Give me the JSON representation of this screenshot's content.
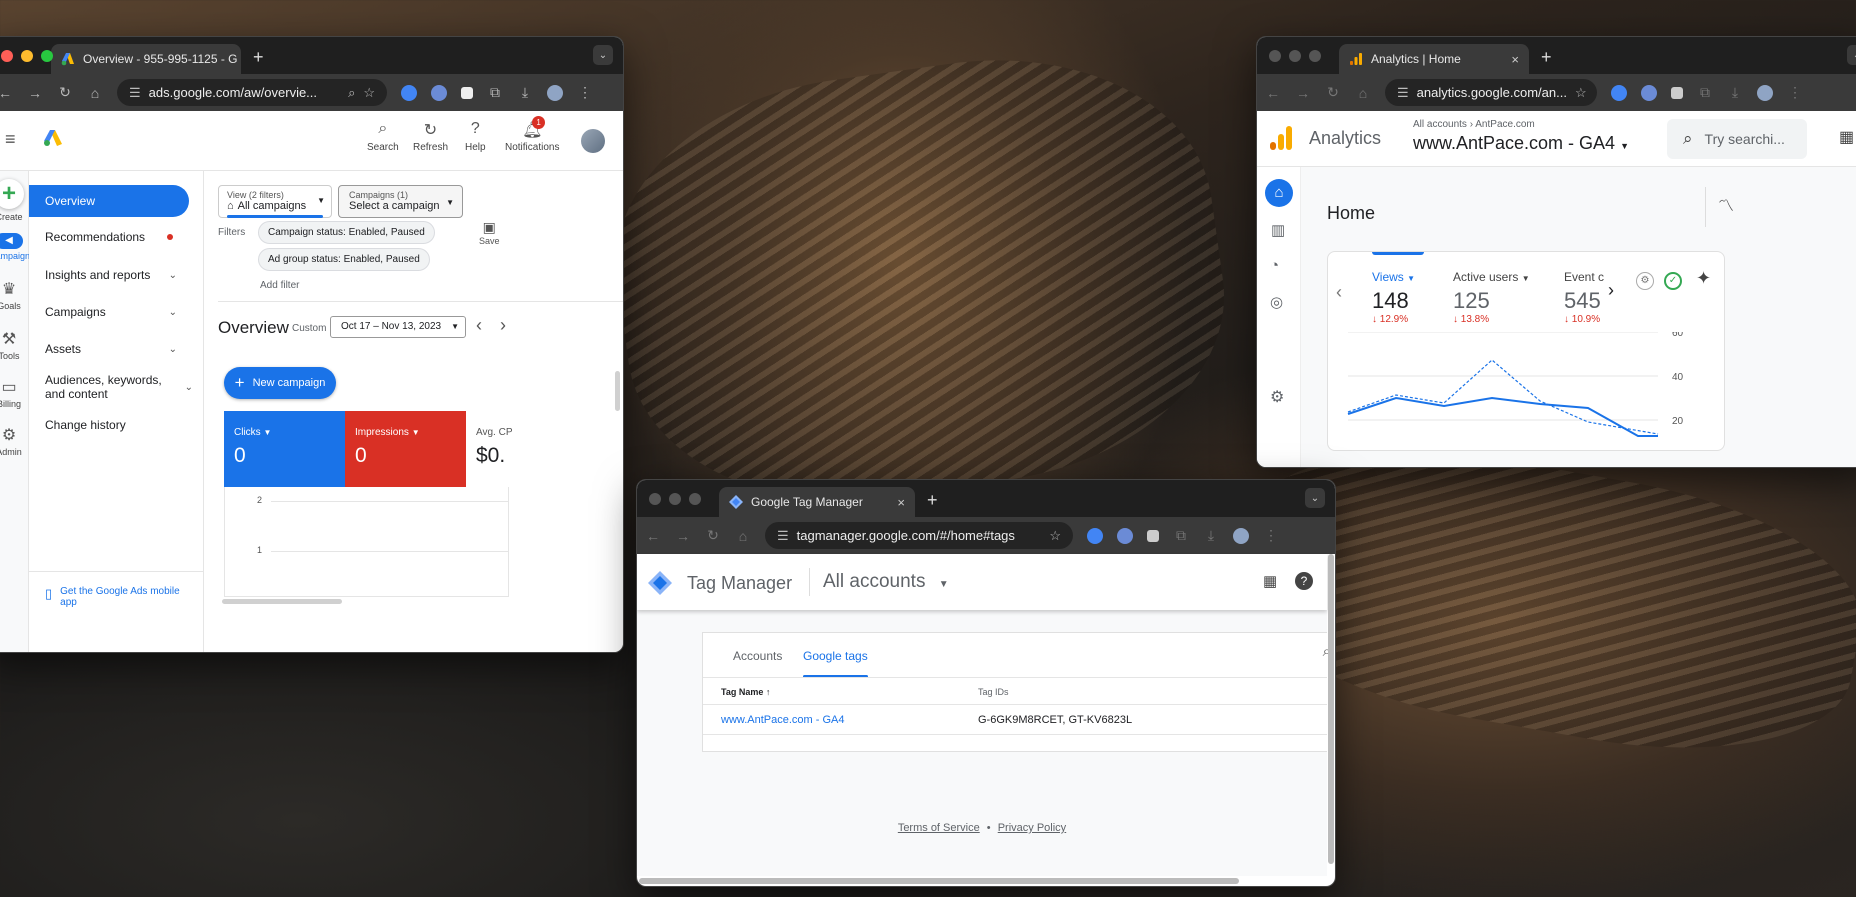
{
  "ads_window": {
    "tab_title": "Overview - 955-995-1125 - G",
    "url": "ads.google.com/aw/overvie...",
    "header": {
      "search_label": "Search",
      "refresh_label": "Refresh",
      "help_label": "Help",
      "notifications_label": "Notifications",
      "notifications_count": "1"
    },
    "rail": {
      "create": "Create",
      "campaigns": "Campaigns",
      "goals": "Goals",
      "tools": "Tools",
      "billing": "Billing",
      "admin": "Admin"
    },
    "nav": {
      "overview": "Overview",
      "recommendations": "Recommendations",
      "insights": "Insights and reports",
      "campaigns": "Campaigns",
      "assets": "Assets",
      "audiences": "Audiences, keywords, and content",
      "change_history": "Change history",
      "mobile_app": "Get the Google Ads mobile app"
    },
    "view_filter": {
      "label": "View (2 filters)",
      "value": "All campaigns"
    },
    "campaign_filter": {
      "label": "Campaigns (1)",
      "value": "Select a campaign"
    },
    "filters_label": "Filters",
    "filter_chips": [
      "Campaign status: Enabled, Paused",
      "Ad group status: Enabled, Paused"
    ],
    "add_filter": "Add filter",
    "save_label": "Save",
    "overview_title": "Overview",
    "custom_label": "Custom",
    "date_range": "Oct 17 – Nov 13, 2023",
    "new_campaign": "New campaign",
    "metrics": [
      {
        "label": "Clicks",
        "value": "0",
        "color": "#1a73e8"
      },
      {
        "label": "Impressions",
        "value": "0",
        "color": "#d93025"
      },
      {
        "label": "Avg. CP",
        "value": "$0."
      }
    ],
    "chart_ticks": [
      "2",
      "1"
    ]
  },
  "ga_window": {
    "tab_title": "Analytics | Home",
    "url": "analytics.google.com/an...",
    "app_name": "Analytics",
    "breadcrumb_root": "All accounts",
    "breadcrumb_account": "AntPace.com",
    "property": "www.AntPace.com - GA4",
    "search_placeholder": "Try searchi...",
    "home_title": "Home",
    "metrics": [
      {
        "label": "Views",
        "value": "148",
        "change": "12.9%"
      },
      {
        "label": "Active users",
        "value": "125",
        "change": "13.8%"
      },
      {
        "label": "Event c",
        "value": "545",
        "change": "10.9%"
      }
    ],
    "chart_ticks": [
      "60",
      "40",
      "20"
    ]
  },
  "gtm_window": {
    "tab_title": "Google Tag Manager",
    "url": "tagmanager.google.com/#/home#tags",
    "app_name": "Tag Manager",
    "account_selector": "All accounts",
    "tabs": {
      "accounts": "Accounts",
      "google_tags": "Google tags"
    },
    "columns": {
      "name": "Tag Name",
      "ids": "Tag IDs"
    },
    "rows": [
      {
        "name": "www.AntPace.com - GA4",
        "ids": "G-6GK9M8RCET, GT-KV6823L"
      }
    ],
    "footer": {
      "terms": "Terms of Service",
      "separator": "•",
      "privacy": "Privacy Policy"
    }
  },
  "colors": {
    "google_blue": "#1a73e8",
    "google_red": "#d93025",
    "google_yellow": "#fbbc04",
    "google_green": "#34a853",
    "ga_orange": "#f9ab00",
    "tab_bar": "#1f1f1f",
    "toolbar": "#3a3a3a"
  }
}
